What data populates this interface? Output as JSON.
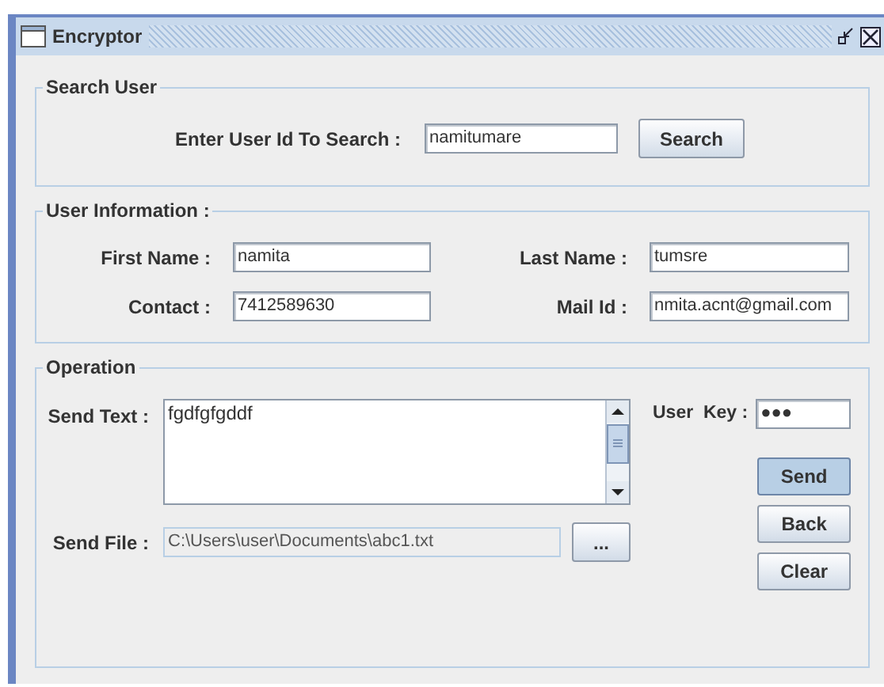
{
  "window": {
    "title": "Encryptor"
  },
  "search_user": {
    "legend": "Search User",
    "label": "Enter User Id To Search :",
    "value": "namitumare",
    "button": "Search"
  },
  "user_information": {
    "legend": "User Information :",
    "fields": [
      {
        "label": "First Name :",
        "value": "namita"
      },
      {
        "label": "Last Name :",
        "value": "tumsre"
      },
      {
        "label": "Contact :",
        "value": "7412589630"
      },
      {
        "label": "Mail Id :",
        "value": "nmita.acnt@gmail.com"
      }
    ]
  },
  "operation": {
    "legend": "Operation",
    "send_text_label": "Send Text :",
    "send_text": "fgdfgfgddf",
    "send_file_label": "Send File :",
    "send_file": "C:\\Users\\user\\Documents\\abc1.txt",
    "send_file_disabled": true,
    "browse_button": "...",
    "user_key_label": "User  Key :",
    "user_key": "●●●",
    "buttons": [
      {
        "label": "Send",
        "focused": true
      },
      {
        "label": "Back",
        "focused": false
      },
      {
        "label": "Clear",
        "focused": false
      }
    ]
  }
}
